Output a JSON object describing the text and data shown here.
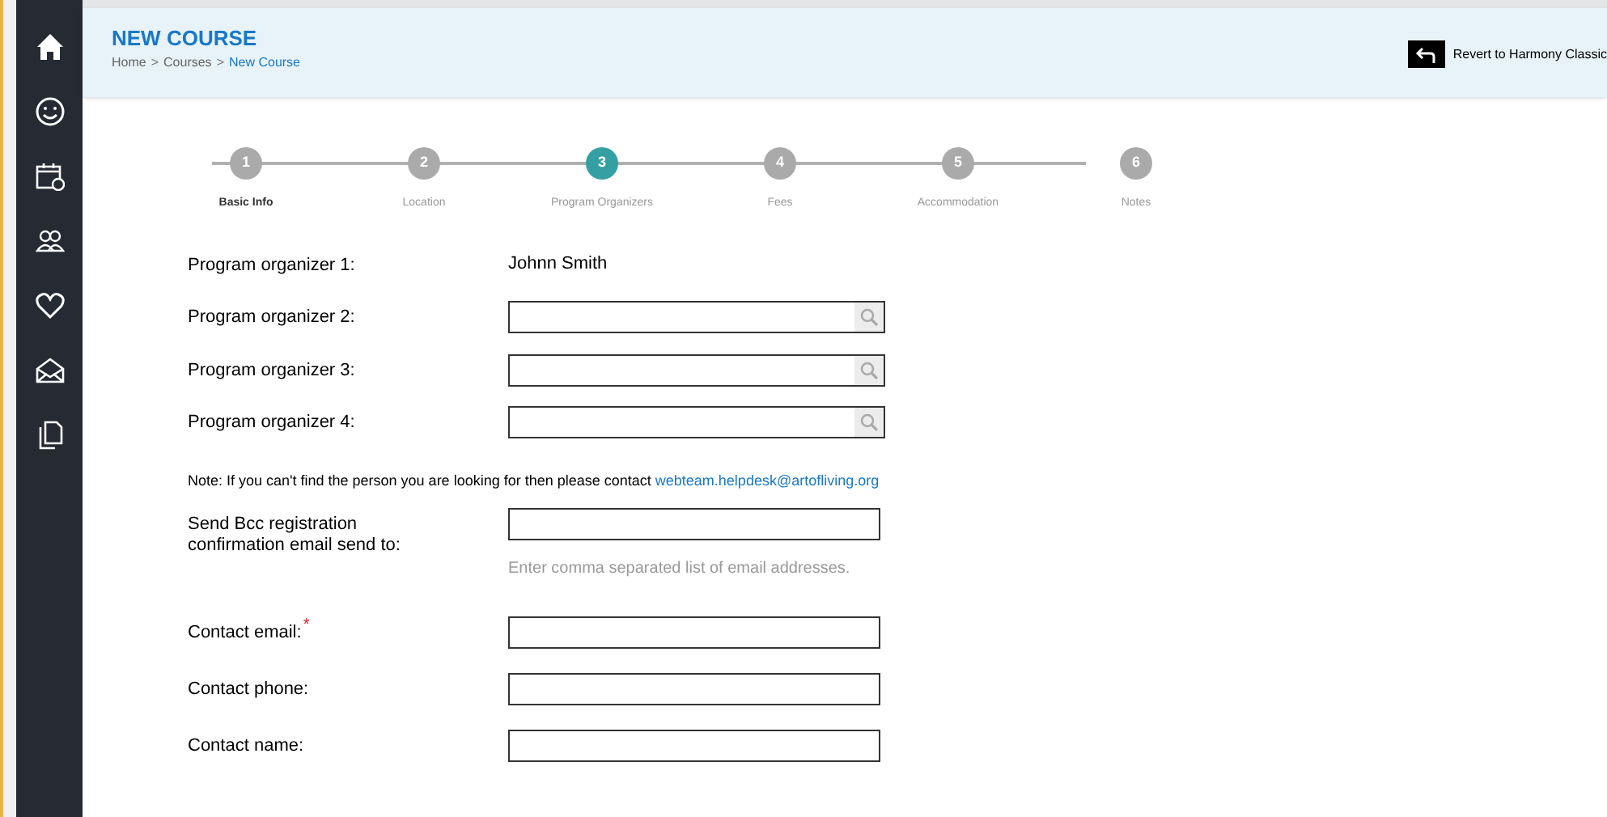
{
  "header": {
    "title": "NEW COURSE",
    "breadcrumb": [
      {
        "label": "Home",
        "current": false
      },
      {
        "label": "Courses",
        "current": false
      },
      {
        "label": "New Course",
        "current": true
      }
    ],
    "separator": ">",
    "revert_button": "Revert to Harmony Classic"
  },
  "steps": [
    {
      "number": "1",
      "label": "Basic Info",
      "selected": false,
      "completed": true
    },
    {
      "number": "2",
      "label": "Location",
      "selected": false,
      "completed": false
    },
    {
      "number": "3",
      "label": "Program Organizers",
      "selected": true,
      "completed": false
    },
    {
      "number": "4",
      "label": "Fees",
      "selected": false,
      "completed": false
    },
    {
      "number": "5",
      "label": "Accommodation",
      "selected": false,
      "completed": false
    },
    {
      "number": "6",
      "label": "Notes",
      "selected": false,
      "completed": false
    }
  ],
  "form": [
    {
      "kind": "value",
      "label": "Program organizer 1:",
      "value": "Johnn Smith"
    },
    {
      "kind": "search",
      "label": "Program organizer 2:"
    },
    {
      "kind": "search",
      "label": "Program organizer 3:"
    },
    {
      "kind": "search",
      "label": "Program organizer 4:"
    },
    {
      "kind": "note",
      "text": "Note: If you can't find the person you are looking for then please contact",
      "link": "webteam.helpdesk@artofliving.org"
    },
    {
      "kind": "input",
      "label": "Send Bcc registration confirmation email send to:",
      "hint": "Enter comma separated list of email addresses."
    },
    {
      "kind": "input",
      "label": "Contact email:",
      "required": true,
      "required_mark": "*"
    },
    {
      "kind": "input",
      "label": "Contact phone:"
    },
    {
      "kind": "input",
      "label": "Contact name:"
    }
  ]
}
